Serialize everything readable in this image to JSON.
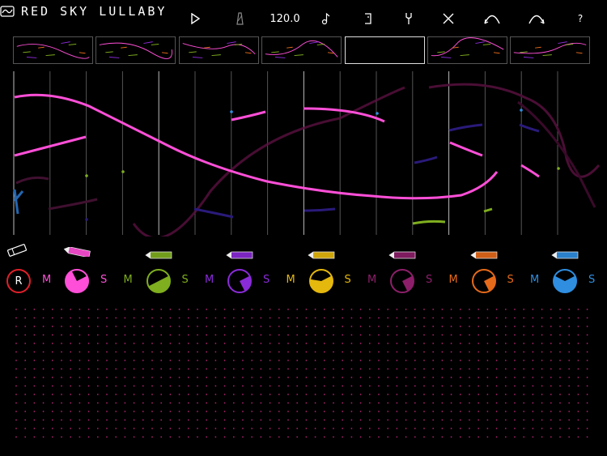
{
  "title": "RED SKY LULLABY",
  "toolbar": {
    "tempo": "120.0",
    "help": "?",
    "icons": [
      "play-icon",
      "metronome-icon",
      "tempo",
      "note-icon",
      "loop-icon",
      "tuning-fork-icon",
      "clear-icon",
      "curve-up-icon",
      "curve-arrow-icon",
      "help-icon"
    ]
  },
  "record_label": "R",
  "mute_label": "M",
  "solo_label": "S",
  "colors": {
    "pink": "#ff4fd8",
    "green": "#7fae1f",
    "purple": "#8a2bd8",
    "yellow": "#e5b80e",
    "magenta": "#8d1f6a",
    "orange": "#e66a1a",
    "blue": "#2f8ee0",
    "red": "#e0202a",
    "dot": "#b0246e"
  },
  "tracks": [
    {
      "color": "pink",
      "fill": 0.75
    },
    {
      "color": "green",
      "fill": 0.5
    },
    {
      "color": "purple",
      "fill": 0.25
    },
    {
      "color": "yellow",
      "fill": 0.6
    },
    {
      "color": "magenta",
      "fill": 0.25
    },
    {
      "color": "orange",
      "fill": 0.25
    },
    {
      "color": "blue",
      "fill": 0.65
    }
  ],
  "pattern_count": 7,
  "active_pattern": 5
}
